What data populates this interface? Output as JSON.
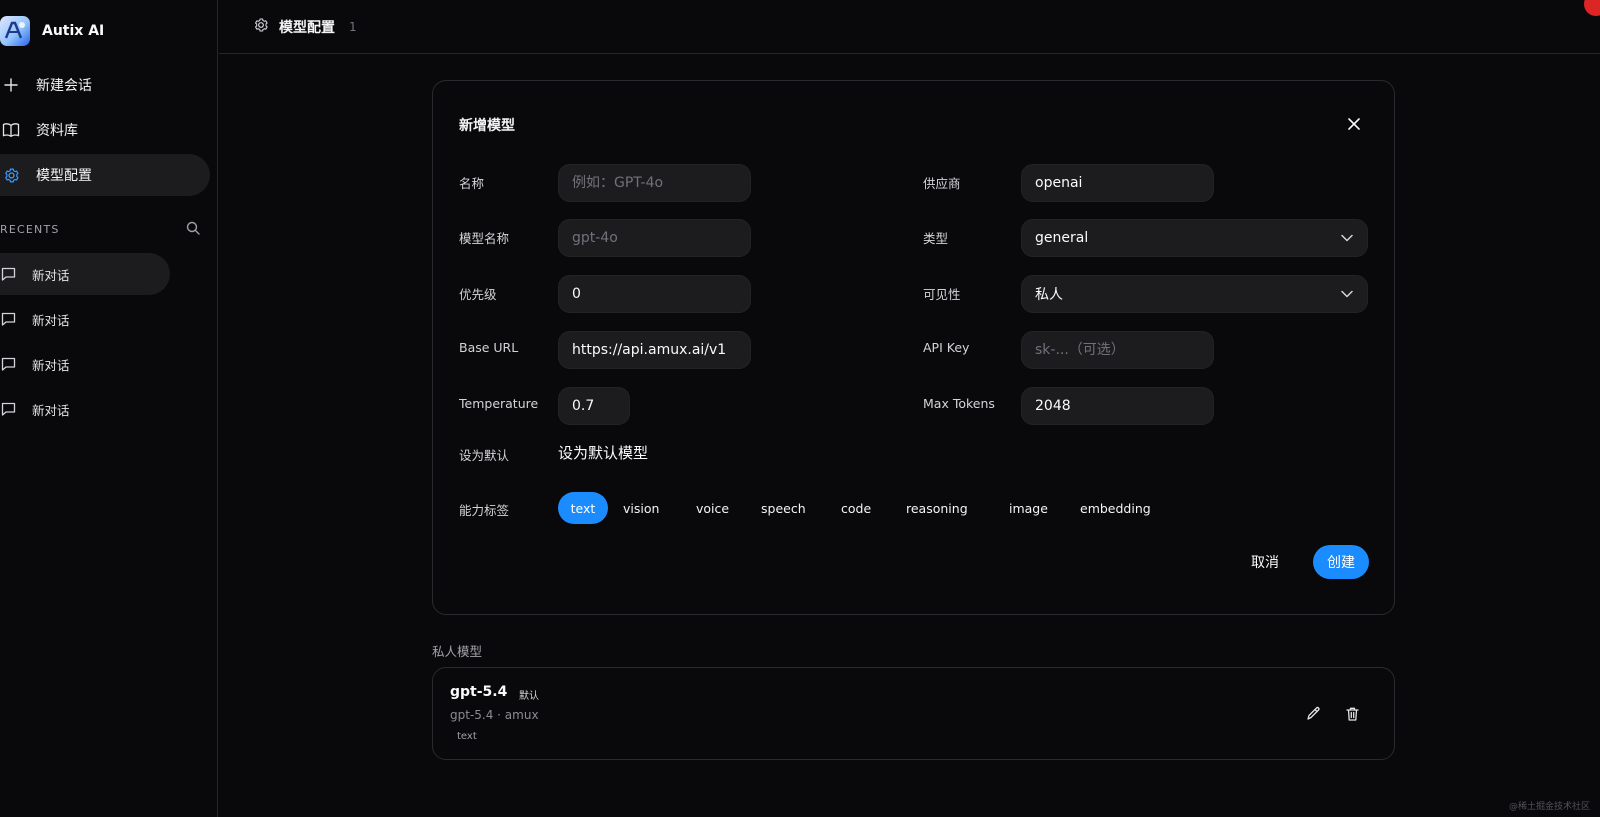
{
  "app": {
    "name": "Autix AI"
  },
  "sidebar": {
    "nav": [
      {
        "label": "新建会话",
        "icon": "plus-icon"
      },
      {
        "label": "资料库",
        "icon": "book-icon"
      },
      {
        "label": "模型配置",
        "icon": "gear-icon"
      }
    ],
    "recents_label": "RECENTS",
    "recents": [
      {
        "label": "新对话"
      },
      {
        "label": "新对话"
      },
      {
        "label": "新对话"
      },
      {
        "label": "新对话"
      }
    ]
  },
  "header": {
    "title": "模型配置",
    "count": "1"
  },
  "dialog": {
    "title": "新增模型",
    "fields": {
      "name": {
        "label": "名称",
        "value": "",
        "placeholder": "例如：GPT-4o"
      },
      "provider": {
        "label": "供应商",
        "value": "openai"
      },
      "model_name": {
        "label": "模型名称",
        "value": "",
        "placeholder": "gpt-4o"
      },
      "type": {
        "label": "类型",
        "value": "general"
      },
      "priority": {
        "label": "优先级",
        "value": "0"
      },
      "visibility": {
        "label": "可见性",
        "value": "私人"
      },
      "base_url": {
        "label": "Base URL",
        "value": "https://api.amux.ai/v1"
      },
      "api_key": {
        "label": "API Key",
        "value": "",
        "placeholder": "sk-...（可选）"
      },
      "temperature": {
        "label": "Temperature",
        "value": "0.7"
      },
      "max_tokens": {
        "label": "Max Tokens",
        "value": "2048"
      },
      "set_default": {
        "label": "设为默认",
        "text": "设为默认模型"
      },
      "capabilities": {
        "label": "能力标签",
        "options": [
          "text",
          "vision",
          "voice",
          "speech",
          "code",
          "reasoning",
          "image",
          "embedding"
        ],
        "selected": "text"
      }
    },
    "cancel_label": "取消",
    "create_label": "创建"
  },
  "private_models": {
    "section_label": "私人模型",
    "items": [
      {
        "name": "gpt-5.4",
        "badge": "默认",
        "subtitle": "gpt-5.4 · amux",
        "tag": "text"
      }
    ]
  },
  "watermark": "@稀土掘金技术社区",
  "colors": {
    "accent": "#1a8cff",
    "background": "#09090b",
    "surface": "#1c1c1f",
    "border": "#27272a"
  }
}
